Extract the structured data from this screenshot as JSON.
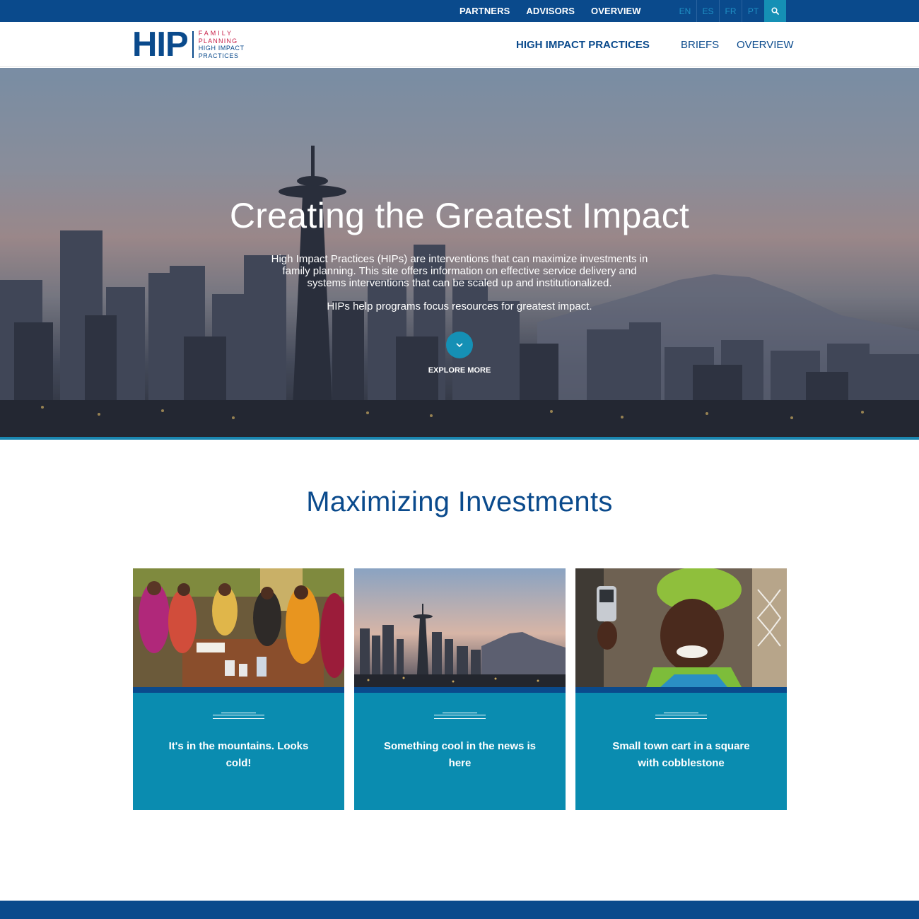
{
  "topbar": {
    "links": [
      "PARTNERS",
      "ADVISORS",
      "OVERVIEW"
    ],
    "languages": [
      "EN",
      "ES",
      "FR",
      "PT"
    ],
    "search_icon": "search-icon"
  },
  "header": {
    "logo": {
      "mark": "HIP",
      "line1": "FAMILY",
      "line2": "PLANNING",
      "line3": "HIGH IMPACT",
      "line4": "PRACTICES"
    },
    "nav": [
      "HIGH IMPACT PRACTICES",
      "BRIEFS",
      "OVERVIEW"
    ]
  },
  "hero": {
    "title": "Creating the Greatest Impact",
    "description": "High Impact Practices (HIPs) are interventions that can maximize investments in family planning. This site offers information on effective service delivery and systems interventions that can be scaled up and institutionalized.",
    "subtext": "HIPs help programs focus resources for greatest impact.",
    "explore_label": "EXPLORE MORE",
    "explore_icon": "chevron-down-icon"
  },
  "section": {
    "title": "Maximizing Investments"
  },
  "cards": [
    {
      "caption": "It's in the mountains. Looks cold!",
      "image": "women-group-photo"
    },
    {
      "caption": "Something cool in the news is here",
      "image": "city-skyline-photo"
    },
    {
      "caption": "Small town cart in a square with cobblestone",
      "image": "woman-with-phone-photo"
    }
  ],
  "colors": {
    "brand_blue": "#0a4a8c",
    "accent_teal": "#1590b5",
    "card_teal": "#0a8cb0",
    "logo_red": "#c8224a"
  }
}
